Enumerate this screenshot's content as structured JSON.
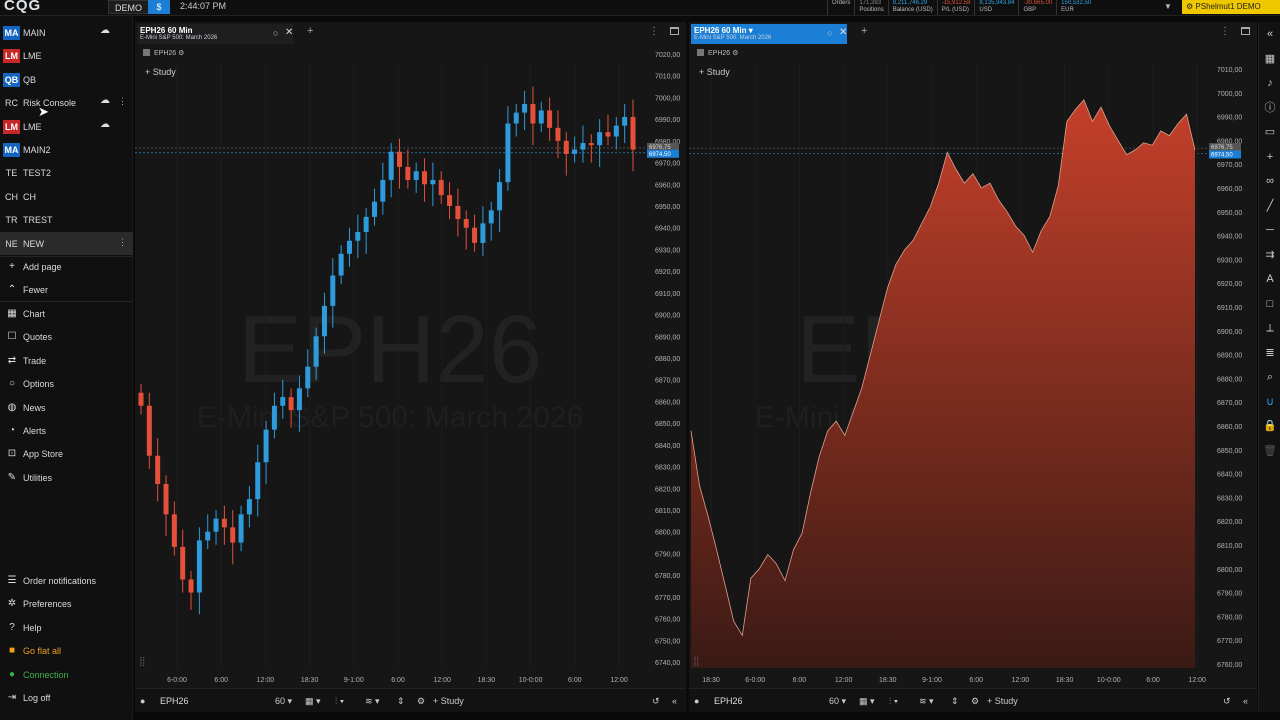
{
  "topbar": {
    "logo": "CQG",
    "demo_label": "DEMO",
    "dollar_label": "$",
    "time": "2:44:07 PM",
    "stats": [
      {
        "value": "",
        "label": "Orders"
      },
      {
        "value": "171,393",
        "label": "Positions"
      },
      {
        "value": "8,211,746.29",
        "label": "Balance (USD)"
      },
      {
        "value": "-15,912.58",
        "label": "P/L (USD)"
      },
      {
        "value": "8,135,943.84",
        "label": "USD"
      },
      {
        "value": "-30,665.00",
        "label": "GBP"
      },
      {
        "value": "150,532.50",
        "label": "EUR"
      }
    ],
    "account": "PShelmut1 DEMO"
  },
  "sidebar": {
    "workspaces": [
      {
        "abbr": "MA",
        "name": "MAIN",
        "color": "#1565c0",
        "cloud": true
      },
      {
        "abbr": "LM",
        "name": "LME",
        "color": "#c62828",
        "cloud": false
      },
      {
        "abbr": "QB",
        "name": "QB",
        "color": "#1565c0",
        "cloud": false
      },
      {
        "abbr": "RC",
        "name": "Risk Console",
        "color": "",
        "cloud": true
      },
      {
        "abbr": "LM",
        "name": "LME",
        "color": "#c62828",
        "cloud": true
      },
      {
        "abbr": "MA",
        "name": "MAIN2",
        "color": "#1565c0",
        "cloud": false
      },
      {
        "abbr": "TE",
        "name": "TEST2",
        "color": "",
        "cloud": false
      },
      {
        "abbr": "CH",
        "name": "CH",
        "color": "",
        "cloud": false
      },
      {
        "abbr": "TR",
        "name": "TREST",
        "color": "",
        "cloud": false
      },
      {
        "abbr": "NE",
        "name": "NEW",
        "color": "",
        "cloud": false
      }
    ],
    "add_page": "Add page",
    "fewer": "Fewer",
    "nav": [
      {
        "icon": "chart-icon",
        "glyph": "▦",
        "label": "Chart"
      },
      {
        "icon": "quotes-icon",
        "glyph": "☐",
        "label": "Quotes"
      },
      {
        "icon": "trade-icon",
        "glyph": "⇄",
        "label": "Trade"
      },
      {
        "icon": "options-icon",
        "glyph": "○",
        "label": "Options"
      },
      {
        "icon": "news-icon",
        "glyph": "◍",
        "label": "News"
      },
      {
        "icon": "alerts-icon",
        "glyph": "◔",
        "label": "Alerts"
      },
      {
        "icon": "app-store-icon",
        "glyph": "⊡",
        "label": "App Store"
      },
      {
        "icon": "utilities-icon",
        "glyph": "✎",
        "label": "Utilities"
      }
    ],
    "bottom": [
      {
        "icon": "order-notifications-icon",
        "glyph": "☰",
        "label": "Order notifications",
        "style": ""
      },
      {
        "icon": "preferences-icon",
        "glyph": "✲",
        "label": "Preferences",
        "style": ""
      },
      {
        "icon": "help-icon",
        "glyph": "?",
        "label": "Help",
        "style": ""
      },
      {
        "icon": "go-flat-icon",
        "glyph": "■",
        "label": "Go flat all",
        "style": "orange"
      },
      {
        "icon": "connection-icon",
        "glyph": "●",
        "label": "Connection",
        "style": "green"
      },
      {
        "icon": "logout-icon",
        "glyph": "⇥",
        "label": "Log off",
        "style": ""
      }
    ]
  },
  "panels": [
    {
      "title": "EPH26 60 Min",
      "subtitle": "E-Mini S&P 500: March 2026",
      "legend": "EPH26",
      "study": "Study",
      "watermark_symbol": "EPH26",
      "watermark_name": "E-Mini S&P 500: March 2026",
      "symbol": "EPH26",
      "interval": "60",
      "price_labels": [
        "7020,00",
        "7010,00",
        "7000,00",
        "6990,00",
        "6980,00",
        "6970,00",
        "6960,00",
        "6950,00",
        "6940,00",
        "6930,00",
        "6920,00",
        "6910,00",
        "6900,00",
        "6890,00",
        "6880,00",
        "6870,00",
        "6860,00",
        "6850,00",
        "6840,00",
        "6830,00",
        "6820,00",
        "6810,00",
        "6800,00",
        "6790,00",
        "6780,00",
        "6770,00",
        "6760,00",
        "6750,00",
        "6740,00"
      ],
      "time_labels": [
        "6-0:00",
        "6:00",
        "12:00",
        "18:30",
        "9-1:00",
        "6:00",
        "12:00",
        "18:30",
        "10-0:00",
        "6:00",
        "12:00"
      ],
      "last_price_labels": [
        "6976,75",
        "6974,50"
      ]
    },
    {
      "title": "EPH26 60 Min",
      "subtitle": "E-Mini S&P 500: March 2026",
      "legend": "EPH26",
      "study": "Study",
      "watermark_symbol": "EPH26",
      "watermark_name": "E-Mini S&P 500: March 2026",
      "symbol": "EPH26",
      "interval": "60",
      "price_labels": [
        "7010,00",
        "7000,00",
        "6990,00",
        "6980,00",
        "6970,00",
        "6960,00",
        "6950,00",
        "6940,00",
        "6930,00",
        "6920,00",
        "6910,00",
        "6900,00",
        "6890,00",
        "6880,00",
        "6870,00",
        "6860,00",
        "6850,00",
        "6840,00",
        "6830,00",
        "6820,00",
        "6810,00",
        "6800,00",
        "6790,00",
        "6780,00",
        "6770,00",
        "6760,00"
      ],
      "time_labels": [
        "18:30",
        "6-0:00",
        "6:00",
        "12:00",
        "18:30",
        "9-1:00",
        "6:00",
        "12:00",
        "18:30",
        "10-0:00",
        "6:00",
        "12:00"
      ],
      "last_price_labels": [
        "6976,75",
        "6974,50"
      ]
    }
  ],
  "price_series": {
    "prices": [
      6858,
      6835,
      6822,
      6808,
      6793,
      6778,
      6772,
      6796,
      6800,
      6806,
      6802,
      6795,
      6808,
      6815,
      6832,
      6847,
      6858,
      6862,
      6856,
      6866,
      6876,
      6890,
      6904,
      6918,
      6928,
      6934,
      6938,
      6945,
      6952,
      6962,
      6975,
      6968,
      6962,
      6966,
      6960,
      6962,
      6955,
      6950,
      6944,
      6940,
      6933,
      6942,
      6948,
      6961,
      6988,
      6993,
      6997,
      6988,
      6994,
      6986,
      6980,
      6974,
      6976,
      6979,
      6978,
      6984,
      6982,
      6987,
      6991,
      6976
    ]
  },
  "colors": {
    "up": "#2e9bdc",
    "down": "#e4503a",
    "area": "#c4402a",
    "accent": "#1c7fd6"
  }
}
